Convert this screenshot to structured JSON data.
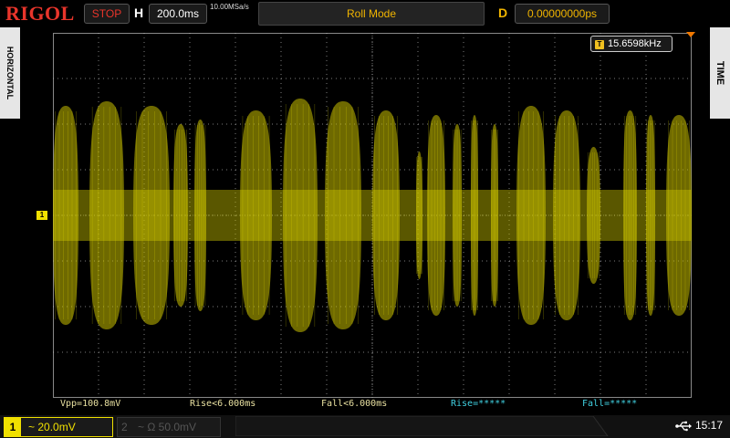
{
  "header": {
    "brand": "RIGOL",
    "run_state": "STOP",
    "horizontal_label": "H",
    "timebase": "200.0ms",
    "sample_rate": "10.00MSa/s",
    "mode": "Roll Mode",
    "delay_label": "D",
    "delay": "0.00000000ps"
  },
  "side_tabs": {
    "left": "HORIZONTAL",
    "right": "TIME"
  },
  "trigger": {
    "frequency": "15.6598kHz",
    "icon": "T"
  },
  "channel1_marker": "1",
  "measurements": [
    {
      "text": "Vpp=100.8mV",
      "color": "#e8e0a0"
    },
    {
      "text": "Rise<6.000ms",
      "color": "#e8e0a0"
    },
    {
      "text": "Fall<6.000ms",
      "color": "#e8e0a0"
    },
    {
      "text": "Rise=*****",
      "color": "#40d0e0"
    },
    {
      "text": "Fall=*****",
      "color": "#40d0e0"
    }
  ],
  "channels": [
    {
      "number": "1",
      "coupling": "~",
      "scale": "20.0mV",
      "active": true
    },
    {
      "number": "2",
      "coupling": "~ Ω",
      "scale": "50.0mV",
      "active": false
    }
  ],
  "status": {
    "usb_icon": "usb-icon",
    "time": "15:17"
  },
  "colors": {
    "brand": "#e8352b",
    "accent": "#f0b400",
    "trace": "#c8c000",
    "grid": "#cfcfcf",
    "measure_cyan": "#40d0e0"
  }
}
